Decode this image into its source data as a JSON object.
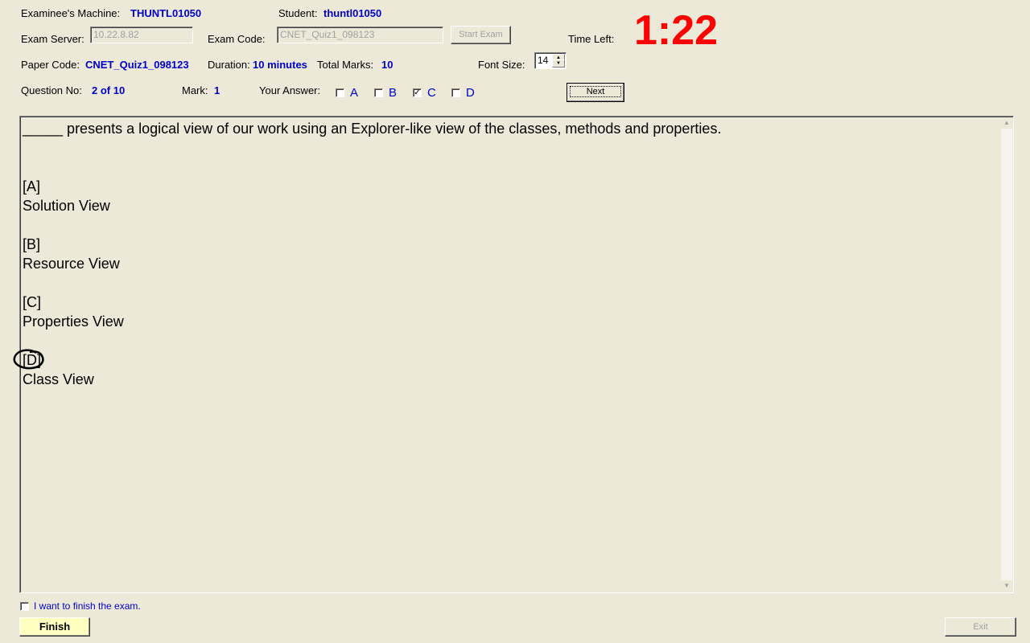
{
  "header": {
    "machine_label": "Examinee's Machine:",
    "machine_value": "THUNTL01050",
    "student_label": "Student:",
    "student_value": "thuntl01050",
    "server_label": "Exam Server:",
    "server_value": "10.22.8.82",
    "exam_code_label": "Exam Code:",
    "exam_code_value": "CNET_Quiz1_098123",
    "start_exam_label": "Start Exam",
    "time_left_label": "Time Left:",
    "time_left_value": "1:22",
    "paper_code_label": "Paper Code:",
    "paper_code_value": "CNET_Quiz1_098123",
    "duration_label": "Duration:",
    "duration_value": "10 minutes",
    "total_marks_label": "Total Marks:",
    "total_marks_value": "10",
    "font_size_label": "Font Size:",
    "font_size_value": "14",
    "question_no_label": "Question No:",
    "question_no_value": "2 of 10",
    "mark_label": "Mark:",
    "mark_value": "1",
    "your_answer_label": "Your Answer:",
    "next_label": "Next"
  },
  "answers": [
    {
      "label": "A",
      "checked": false
    },
    {
      "label": "B",
      "checked": false
    },
    {
      "label": "C",
      "checked": true
    },
    {
      "label": "D",
      "checked": false
    }
  ],
  "question": {
    "stem": "_____ presents a logical view of our work using an Explorer-like view of the classes, methods and properties.",
    "options": [
      {
        "key": "[A]",
        "text": "Solution View"
      },
      {
        "key": "[B]",
        "text": "Resource View"
      },
      {
        "key": "[C]",
        "text": "Properties View"
      },
      {
        "key": "[D]",
        "text": "Class View"
      }
    ]
  },
  "footer": {
    "finish_check_label": "I want to finish the exam.",
    "finish_label": "Finish",
    "exit_label": "Exit"
  },
  "colors": {
    "timer": "#ff0000",
    "value_text": "#0000cc",
    "background": "#ece9d8",
    "finish_button": "#ffffc0"
  }
}
